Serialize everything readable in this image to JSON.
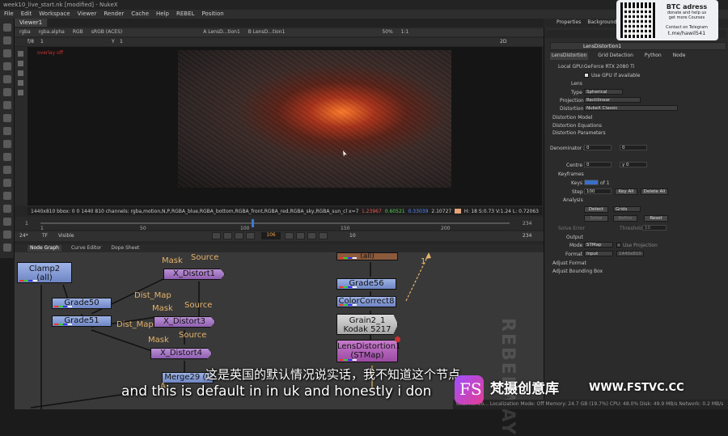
{
  "window": {
    "title": "week10_live_start.nk [modified] - NukeX"
  },
  "menu": [
    "File",
    "Edit",
    "Workspace",
    "Viewer",
    "Render",
    "Cache",
    "Help",
    "REBEL",
    "Position"
  ],
  "viewer": {
    "tab": "Viewer1",
    "channels": "rgba",
    "alpha": "rgba.alpha",
    "display": "RGB",
    "colorspace": "sRGB (ACES)",
    "input_a": "A  LensD...tion1",
    "input_b": "B  LensD...tion1",
    "zoom": "50%",
    "ratio": "1:1",
    "mode": "2D",
    "fstop": "f/8",
    "frame_small": "1",
    "gain_label": "Y",
    "gain_value": "1",
    "overlay_label": "overlay off",
    "status_left": "1440x810  bbox: 0 0 1440 810 channels: rgba,motion,N,P,RGBA_blue,RGBA_bottom,RGBA_front,RGBA_red,RGBA_sky,RGBA_sun_cl   x=706 y=364",
    "status_r": "1.23967",
    "status_g": "0.60521",
    "status_b": "0.33039",
    "status_a": "2.10727",
    "status_hsv": "H: 18 S:0.73 V:1.24  L: 0.72063"
  },
  "timeline": {
    "ticks": [
      "1",
      "50",
      "100",
      "150",
      "200",
      "234"
    ],
    "start": "1",
    "end": "234",
    "current_frame": "106",
    "fps": "24*",
    "tf": "TF",
    "visible": "Visible",
    "step": "10",
    "progress": 0.45
  },
  "dag": {
    "tabs": [
      "Node Graph",
      "Curve Editor",
      "Dope Sheet"
    ],
    "nodes": {
      "clamp2": "Clamp2\n(all)",
      "grade50": "Grade50",
      "grade51": "Grade51",
      "xd1": "X_Distort1",
      "xd3": "X_Distort3",
      "xd4": "X_Distort4",
      "merge29": "Merge29 (h",
      "grade56": "Grade56",
      "cc8": "ColorCorrect8",
      "grain": "Grain2_1\nKodak 5217",
      "lensd": "LensDistortion1\n(STMap)",
      "top": "(all)"
    },
    "labels": {
      "mask": "Mask",
      "source": "Source",
      "distmap": "Dist_Map",
      "one": "1",
      "a": "A"
    }
  },
  "props": {
    "tabs": [
      "Properties",
      "Background"
    ],
    "node_name": "LensDistortion1",
    "subtabs": [
      "LensDistortion",
      "Grid Detection",
      "Python",
      "Node"
    ],
    "gpu_label": "Local GPU:",
    "gpu_value": "GeForce RTX 2080 Ti",
    "use_gpu": "Use GPU if available",
    "lens_section": "Lens",
    "type_label": "Type",
    "type_value": "Spherical",
    "projection_label": "Projection",
    "projection_value": "Rectilinear",
    "distortion_label": "Distortion",
    "distortion_value": "NukeX Classic",
    "groups": [
      "Distortion Model",
      "Distortion Equations",
      "Distortion Parameters"
    ],
    "denominator_label": "Denominator x",
    "denominator_values": [
      "0",
      "0"
    ],
    "centre_label": "Centre x",
    "centre_values": [
      "0",
      "y  0"
    ],
    "keyframes_section": "Keyframes",
    "keys_label": "Keys",
    "keys_of": "of 1",
    "step_label": "Step",
    "step_value": "100",
    "key_all": "Key All",
    "delete_all": "Delete All",
    "analysis_section": "Analysis",
    "detect": "Detect",
    "grids": "Grids",
    "solve": "Solve",
    "refine": "Refine",
    "reset": "Reset",
    "solve_error_label": "Solve Error",
    "threshold_label": "Threshold",
    "threshold_value": "10",
    "output_section": "Output",
    "mode_label": "Mode",
    "mode_value": "STMap",
    "use_projection": "Use Projection",
    "format_label": "Format",
    "format_value": "Input",
    "format_size": "1440x810",
    "adjust_format": "Adjust Format",
    "adjust_bbox": "Adjust Bounding Box"
  },
  "promo": {
    "line1": "BTC adress",
    "line2": "donate and help us",
    "line3": "get more Courses",
    "line4": "Contact on Telegram",
    "line5": "t.me/hawil541"
  },
  "bottom_status": "Channel Co...   Localization Mode: Off  Memory: 24.7 GB (19.7%)  CPU: 48.0%  Disk: 49.9 MB/s  Network: 0.2 MB/s",
  "subtitles": {
    "cn": "这是英国的默认情况说实话，我不知道这个节点",
    "en": "and this is default in in uk and honestly i don"
  },
  "watermark": {
    "logo": "FS",
    "cn": "梵摄创意库",
    "url": "WWW.FSTVC.CC",
    "bg": "REBELWAY"
  }
}
